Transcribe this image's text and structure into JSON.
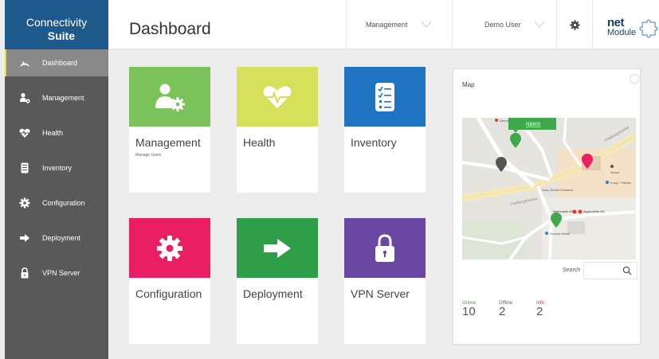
{
  "brand": {
    "line1": "Connectivity",
    "line2": "Suite"
  },
  "sidebar": {
    "items": [
      {
        "label": "Dashboard",
        "icon": "gauge-icon"
      },
      {
        "label": "Management",
        "icon": "user-gear-icon"
      },
      {
        "label": "Health",
        "icon": "heartbeat-icon"
      },
      {
        "label": "Inventory",
        "icon": "checklist-icon"
      },
      {
        "label": "Configuration",
        "icon": "gear-icon"
      },
      {
        "label": "Deployment",
        "icon": "arrow-right-icon"
      },
      {
        "label": "VPN Server",
        "icon": "padlock-icon"
      }
    ]
  },
  "header": {
    "title": "Dashboard",
    "management_select": "Management",
    "user_select": "Demo User",
    "logo_net": "net",
    "logo_module": "Module"
  },
  "tiles": [
    {
      "label": "Management",
      "sub": "Manage Users",
      "color": "#7cc25a",
      "icon": "user-gear-icon"
    },
    {
      "label": "Health",
      "sub": "",
      "color": "#d6e05a",
      "icon": "heartbeat-icon"
    },
    {
      "label": "Inventory",
      "sub": "",
      "color": "#1e73c2",
      "icon": "checklist-icon"
    },
    {
      "label": "Configuration",
      "sub": "",
      "color": "#e91e63",
      "icon": "gear-icon"
    },
    {
      "label": "Deployment",
      "sub": "",
      "color": "#2f9e48",
      "icon": "arrow-right-icon"
    },
    {
      "label": "VPN Server",
      "sub": "",
      "color": "#6a47a3",
      "icon": "padlock-icon"
    }
  ],
  "map": {
    "title": "Map",
    "search_label": "Search",
    "search_value": "",
    "marker_tooltip": "NB800",
    "places": {
      "street1": "Freiburgstrasse",
      "street2": "Freiburgstrasse",
      "poi1": "Dozy Global Solutions",
      "poi2": "Kung + Steiner",
      "poi3": "Netmodule AG",
      "poi4": "Appmodule AG",
      "poi5": "Schenk Metall",
      "poi6": "Denner",
      "poi7": "Schon"
    }
  },
  "stats": [
    {
      "label": "Online",
      "value": "10",
      "color": "#3ea84a"
    },
    {
      "label": "Offline",
      "value": "2",
      "color": "#666666"
    },
    {
      "label": "Info",
      "value": "2",
      "color": "#e91e63"
    }
  ]
}
